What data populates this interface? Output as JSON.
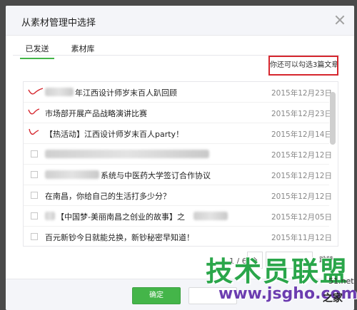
{
  "dialog": {
    "title": "从素材管理中选择",
    "tabs": [
      {
        "label": "已发送",
        "active": true
      },
      {
        "label": "素材库",
        "active": false
      }
    ],
    "hint": "你还可以勾选3篇文章",
    "articles": [
      {
        "title": "年江西设计师岁末百人趴回顾",
        "date": "2015年12月23日",
        "checked": true,
        "title_partially_blurred": true
      },
      {
        "title": "市场部开展产品战略演讲比赛",
        "date": "2015年12月23日",
        "checked": true,
        "title_partially_blurred": false
      },
      {
        "title": "【热活动】江西设计师岁末百人party！",
        "date": "2015年12月14日",
        "checked": true,
        "title_partially_blurred": false
      },
      {
        "title": "",
        "date": "2015年12月12日",
        "checked": false,
        "title_partially_blurred": true
      },
      {
        "title": "系统与中医药大学签订合作协议",
        "date": "2015年12月12日",
        "checked": false,
        "title_partially_blurred": true
      },
      {
        "title": "在南昌，你给自己的生活打多少分？",
        "date": "2015年12月12日",
        "checked": false,
        "title_partially_blurred": false
      },
      {
        "title": "【中国梦-美丽南昌之创业的故事】之",
        "date": "2015年12月05日",
        "checked": false,
        "title_partially_blurred": true
      },
      {
        "title": "百元新钞今日就能兑换，新钞秘密早知道！",
        "date": "2015年11月12日",
        "checked": false,
        "title_partially_blurred": false
      }
    ],
    "pager": {
      "text": "1 / 6",
      "goto_label": "跳转"
    },
    "confirm_label": "确定"
  },
  "watermark": {
    "text": "技术员联盟",
    "url": "www.jsgho.com",
    "side_text": "51.net",
    "side_text2": "之家"
  },
  "colors": {
    "accent": "#44b549",
    "highlight_border": "#d6262e",
    "check_mark": "#d6262e"
  }
}
